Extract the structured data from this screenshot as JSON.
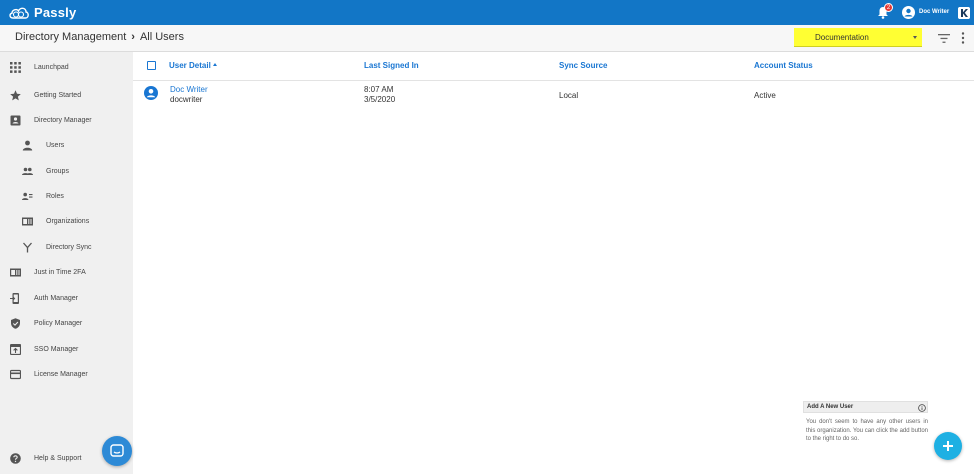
{
  "app": {
    "name": "Passly",
    "notification_count": "2",
    "user_name": "Doc Writer",
    "user_initial": "K"
  },
  "header": {
    "breadcrumb": [
      "Directory Management",
      "All Users"
    ],
    "organization": "Documentation"
  },
  "sidebar": {
    "items": [
      {
        "label": "Launchpad",
        "icon": "apps-grid-icon"
      },
      {
        "label": "Getting Started",
        "icon": "star-icon"
      },
      {
        "label": "Directory Manager",
        "icon": "contact-card-icon"
      },
      {
        "label": "Users",
        "icon": "person-icon"
      },
      {
        "label": "Groups",
        "icon": "people-icon"
      },
      {
        "label": "Roles",
        "icon": "roles-icon"
      },
      {
        "label": "Organizations",
        "icon": "org-card-icon"
      },
      {
        "label": "Directory Sync",
        "icon": "merge-icon"
      },
      {
        "label": "Just in Time 2FA",
        "icon": "badge-card-icon"
      },
      {
        "label": "Auth Manager",
        "icon": "phone-key-icon"
      },
      {
        "label": "Policy Manager",
        "icon": "shield-icon"
      },
      {
        "label": "SSO Manager",
        "icon": "sso-window-icon"
      },
      {
        "label": "License Manager",
        "icon": "credit-card-icon"
      }
    ],
    "help": {
      "label": "Help & Support",
      "icon": "help-icon"
    }
  },
  "table": {
    "columns": [
      "User Detail",
      "Last Signed In",
      "Sync Source",
      "Account Status"
    ],
    "rows": [
      {
        "name": "Doc Writer",
        "username": "docwriter",
        "last_signed_time": "8:07 AM",
        "last_signed_date": "3/5/2020",
        "sync_source": "Local",
        "status": "Active"
      }
    ]
  },
  "hint": {
    "title": "Add A New User",
    "body": "You don't seem to have any other users in this organization. You can click the add button to the right to do so."
  },
  "colors": {
    "topbar": "#1276c6",
    "accent": "#1976d2",
    "highlight": "#ffff33",
    "fab": "#1eb0e3"
  }
}
